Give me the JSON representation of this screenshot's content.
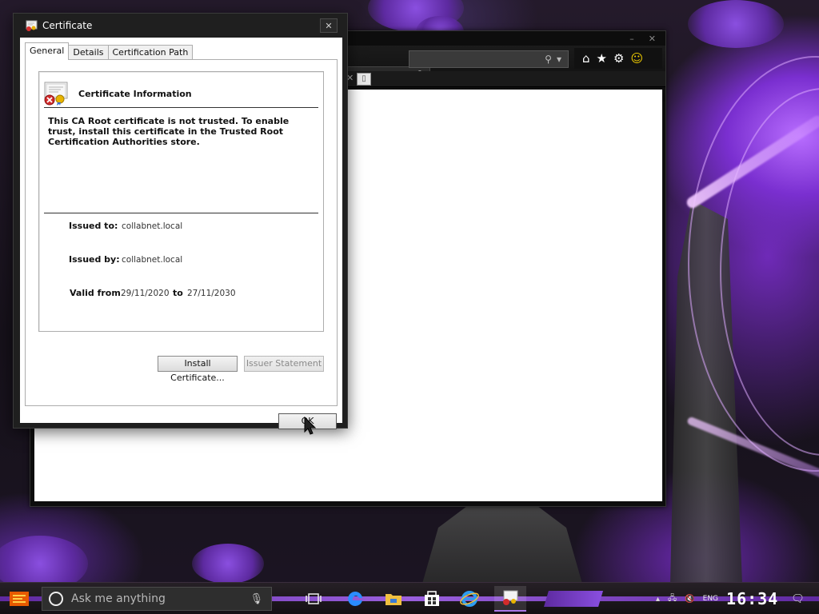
{
  "dialog": {
    "title": "Certificate",
    "tabs": [
      {
        "label": "General",
        "active": true
      },
      {
        "label": "Details",
        "active": false
      },
      {
        "label": "Certification Path",
        "active": false
      }
    ],
    "info_heading": "Certificate Information",
    "warning": "This CA Root certificate is not trusted. To enable trust, install this certificate in the Trusted Root Certification Authorities store.",
    "issued_to_label": "Issued to:",
    "issued_to": "collabnet.local",
    "issued_by_label": "Issued by:",
    "issued_by": "collabnet.local",
    "valid_from_label": "Valid from",
    "valid_from": "29/11/2020",
    "valid_to_label": "to",
    "valid_to": "27/11/2030",
    "install_button": "Install Certificate...",
    "issuer_statement_button": "Issuer Statement",
    "ok_button": "OK",
    "close_glyph": "✕"
  },
  "taskbar": {
    "search_placeholder": "Ask me anything",
    "language": "ENG",
    "clock": "16:34"
  },
  "icons": {
    "home": "home-icon",
    "favorites": "star-icon",
    "tools": "gear-icon",
    "feedback": "smiley-icon"
  },
  "colors": {
    "accent": "#8a4fe0",
    "dialog_frame": "#1f1f1f"
  }
}
